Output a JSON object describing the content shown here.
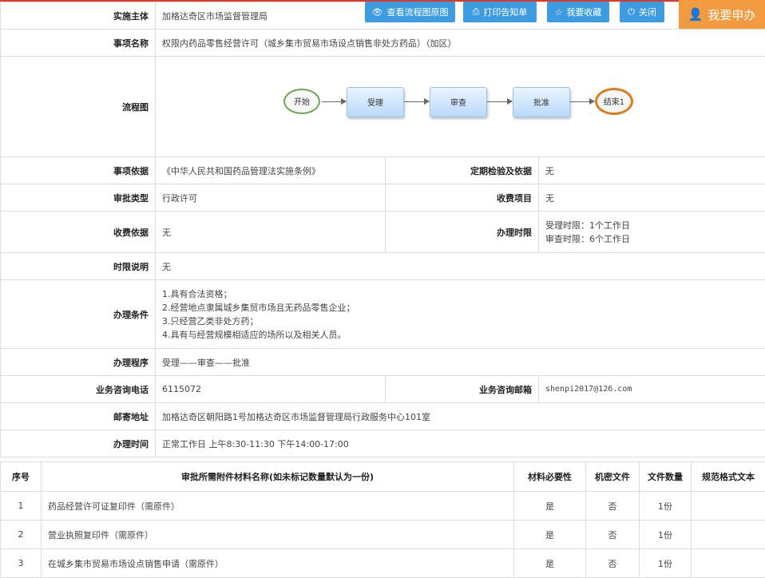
{
  "toolbar": {
    "view_flow": "查看流程图原图",
    "print": "打印告知单",
    "favorite": "我要收藏",
    "close": "关闭",
    "apply": "我要申办"
  },
  "info": {
    "subject_label": "实施主体",
    "subject_value": "加格达奇区市场监督管理局",
    "item_name_label": "事项名称",
    "item_name_value": "权限内药品零售经营许可（城乡集市贸易市场设点销售非处方药品）（加区）",
    "flow_label": "流程图",
    "basis_label": "事项依据",
    "basis_value": "《中华人民共和国药品管理法实施条例》",
    "inspection_label": "定期检验及依据",
    "inspection_value": "无",
    "approval_type_label": "审批类型",
    "approval_type_value": "行政许可",
    "fee_item_label": "收费项目",
    "fee_item_value": "无",
    "fee_basis_label": "收费依据",
    "fee_basis_value": "无",
    "time_limit_label": "办理时限",
    "time_limit_lines": [
      "受理时限：1个工作日",
      "审查时限：6个工作日"
    ],
    "limit_desc_label": "时限说明",
    "limit_desc_value": "无",
    "conditions_label": "办理条件",
    "conditions": [
      "1.具有合法资格；",
      "2.经营地点隶属城乡集贸市场且无药品零售企业；",
      "3.只经营乙类非处方药；",
      "4.具有与经营规模相适应的场所以及相关人员。"
    ],
    "procedure_label": "办理程序",
    "procedure_value": "受理——审查——批准",
    "phone_label": "业务咨询电话",
    "phone_value": "6115072",
    "email_label": "业务咨询邮箱",
    "email_value": "shenpi2017@126.com",
    "address_label": "邮寄地址",
    "address_value": "加格达奇区朝阳路1号加格达奇区市场监督管理局行政服务中心101室",
    "hours_label": "办理时间",
    "hours_value": "正常工作日 上午8:30-11:30 下午14:00-17:00"
  },
  "flow": {
    "start": "开始",
    "steps": [
      "受理",
      "审查",
      "批准"
    ],
    "end": "结束1"
  },
  "materials": {
    "headers": [
      "序号",
      "审批所需附件材料名称(如未标记数量默认为一份)",
      "材料必要性",
      "机密文件",
      "文件数量",
      "规范格式文本"
    ],
    "rows": [
      {
        "no": "1",
        "name": "药品经营许可证复印件（需原件）",
        "required": "是",
        "secret": "否",
        "count": "1份",
        "format": ""
      },
      {
        "no": "2",
        "name": "营业执照复印件（需原件）",
        "required": "是",
        "secret": "否",
        "count": "1份",
        "format": ""
      },
      {
        "no": "3",
        "name": "在城乡集市贸易市场设点销售申请（需原件）",
        "required": "是",
        "secret": "否",
        "count": "1份",
        "format": ""
      }
    ]
  },
  "colors": {
    "toolbar_blue": "#3d9be0",
    "apply_orange": "#f29a3f",
    "start_green": "#6aa84f",
    "end_orange": "#e07b1a",
    "accent_red": "#d93a2b"
  }
}
